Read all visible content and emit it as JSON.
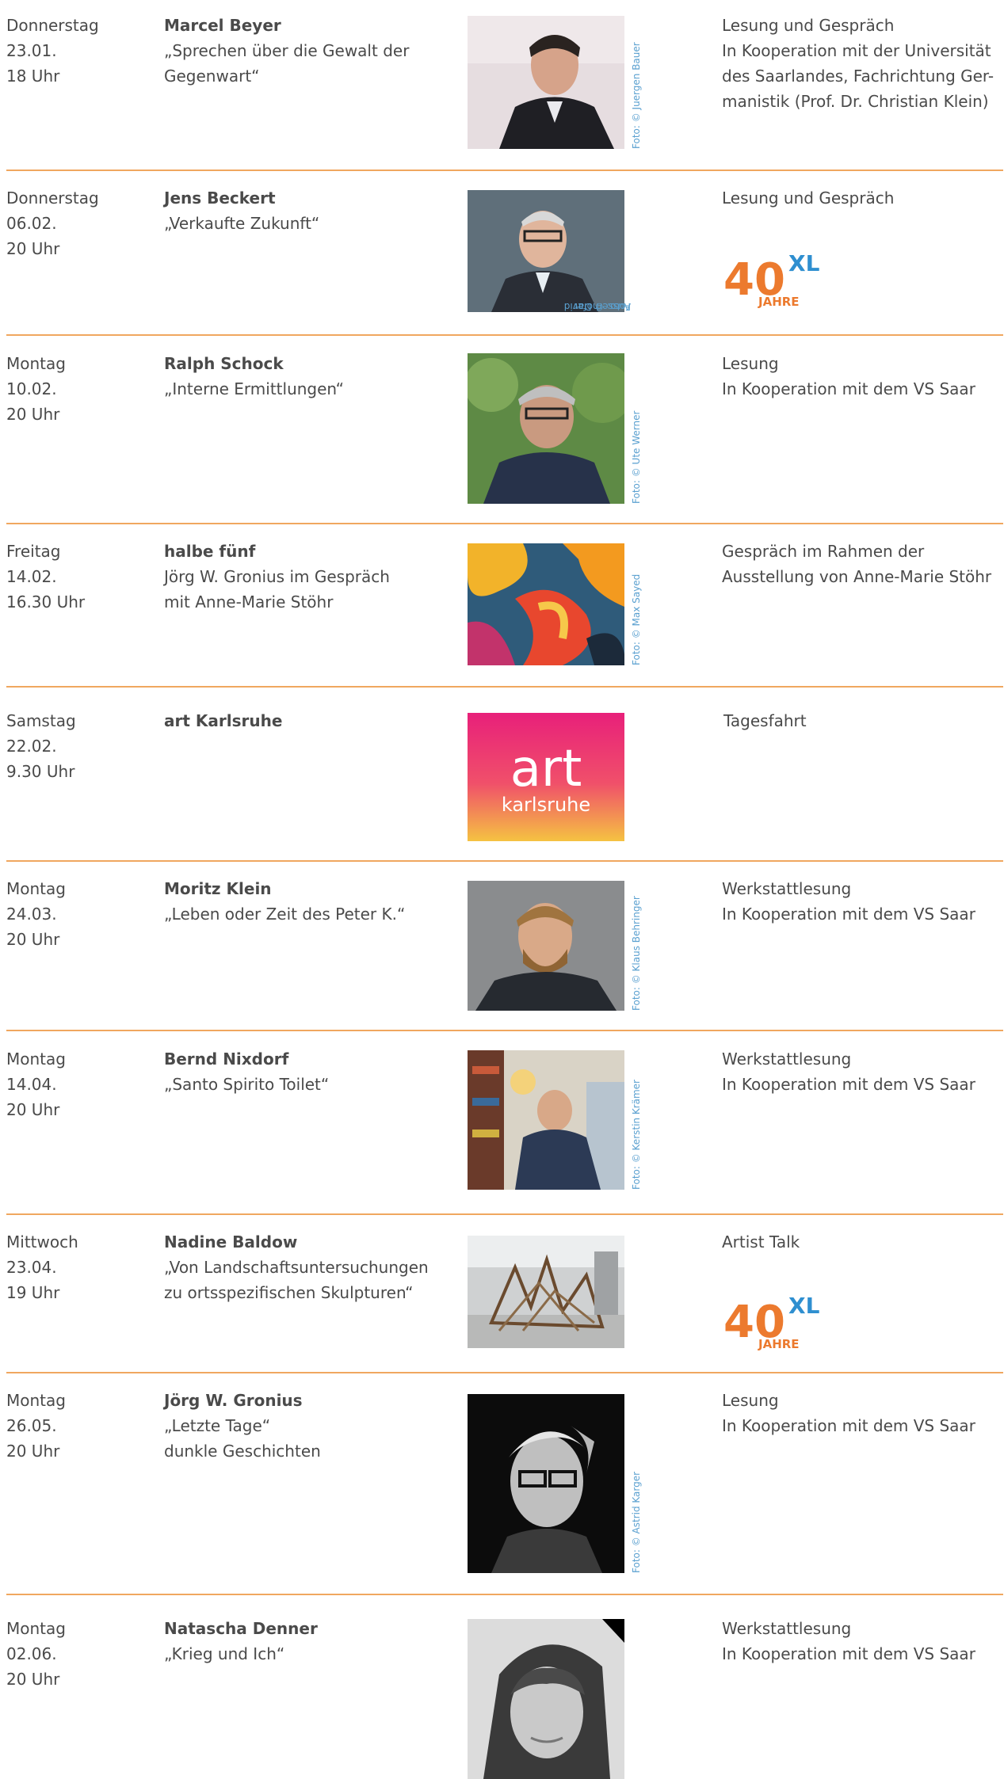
{
  "events": [
    {
      "day": "Donnerstag",
      "date": "23.01.",
      "time": "18 Uhr",
      "name": "Marcel Beyer",
      "title_lines": [
        "„Sprechen über die Gewalt der",
        "Gegenwart“"
      ],
      "info_lines": [
        "Lesung und Gespräch",
        "In Kooperation mit der Universität",
        "des Saarlandes, Fachrichtung Ger-",
        "manistik (Prof. Dr. Christian Klein)"
      ],
      "credit_lines": [
        "Foto: © Juergen Bauer"
      ],
      "photo_desc": "portrait-man-dark-jacket"
    },
    {
      "day": "Donnerstag",
      "date": "06.02.",
      "time": "20 Uhr",
      "name": "Jens Beckert",
      "title_lines": [
        "„Verkaufte Zukunft“"
      ],
      "info_lines": [
        "Lesung und Gespräch"
      ],
      "credit_lines": [
        "Foto: © David",
        "Ausserhofer"
      ],
      "logo": {
        "number": "40",
        "superscript": "XL",
        "sub": "JAHRE"
      }
    },
    {
      "day": "Montag",
      "date": "10.02.",
      "time": "20 Uhr",
      "name": "Ralph Schock",
      "title_lines": [
        "„Interne Ermittlungen“"
      ],
      "info_lines": [
        "Lesung",
        "In Kooperation mit dem VS Saar"
      ],
      "credit_lines": [
        "Foto: © Ute Werner"
      ]
    },
    {
      "day": "Freitag",
      "date": "14.02.",
      "time": "16.30 Uhr",
      "name": "halbe fünf",
      "title_lines": [
        "Jörg W. Gronius im Gespräch",
        "mit Anne-Marie Stöhr"
      ],
      "info_lines": [
        "Gespräch im Rahmen der",
        "Ausstellung von Anne-Marie Stöhr"
      ],
      "credit_lines": [
        "Foto: © Max Sayed"
      ]
    },
    {
      "day": "Samstag",
      "date": "22.02.",
      "time": "9.30 Uhr",
      "name": "art Karlsruhe",
      "title_lines": [],
      "info_lines": [
        "Tagesfahrt"
      ],
      "credit_lines": [],
      "art_logo": {
        "big": "art",
        "small": "karlsruhe"
      }
    },
    {
      "day": "Montag",
      "date": "24.03.",
      "time": "20 Uhr",
      "name": "Moritz Klein",
      "title_lines": [
        "„Leben oder Zeit des Peter K.“"
      ],
      "info_lines": [
        "Werkstattlesung",
        "In Kooperation mit dem VS Saar"
      ],
      "credit_lines": [
        "Foto: © Klaus Behringer"
      ]
    },
    {
      "day": "Montag",
      "date": "14.04.",
      "time": "20 Uhr",
      "name": "Bernd Nixdorf",
      "title_lines": [
        "„Santo Spirito Toilet“"
      ],
      "info_lines": [
        "Werkstattlesung",
        "In Kooperation mit dem VS Saar"
      ],
      "credit_lines": [
        "Foto: © Kerstin Krämer"
      ]
    },
    {
      "day": "Mittwoch",
      "date": "23.04.",
      "time": "19 Uhr",
      "name": "Nadine Baldow",
      "title_lines": [
        "„Von Landschaftsuntersuchungen",
        "zu ortsspezifischen Skulpturen“"
      ],
      "info_lines": [
        "Artist Talk"
      ],
      "credit_lines": [],
      "logo": {
        "number": "40",
        "superscript": "XL",
        "sub": "JAHRE"
      }
    },
    {
      "day": "Montag",
      "date": "26.05.",
      "time": "20 Uhr",
      "name": "Jörg W. Gronius",
      "title_lines": [
        "„Letzte Tage“",
        "dunkle Geschichten"
      ],
      "info_lines": [
        "Lesung",
        "In Kooperation mit dem VS Saar"
      ],
      "credit_lines": [
        "Foto: © Astrid Karger"
      ]
    },
    {
      "day": "Montag",
      "date": "02.06.",
      "time": "20 Uhr",
      "name": "Natascha Denner",
      "title_lines": [
        "„Krieg und Ich“"
      ],
      "info_lines": [
        "Werkstattlesung",
        "In Kooperation mit dem VS Saar"
      ],
      "credit_lines": []
    }
  ],
  "colors": {
    "separator": "#f0a75f",
    "text": "#4a4a4a",
    "credit": "#5aa0d0",
    "logo_orange": "#ec7a2e",
    "logo_blue": "#2f8fd0"
  }
}
